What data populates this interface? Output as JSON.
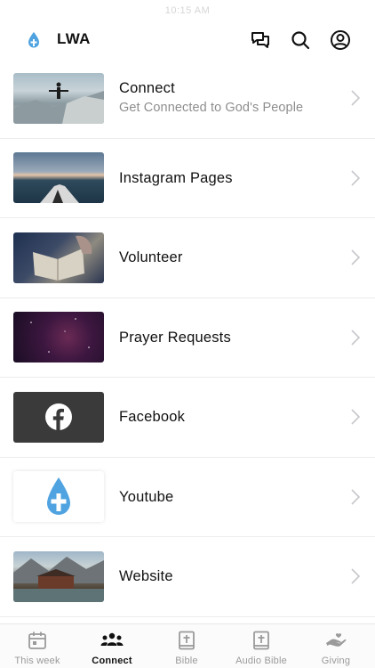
{
  "status_bar": {
    "time": "10:15 AM"
  },
  "header": {
    "title": "LWA"
  },
  "items": [
    {
      "title": "Connect",
      "subtitle": "Get Connected to God's People"
    },
    {
      "title": "Instagram Pages",
      "subtitle": ""
    },
    {
      "title": "Volunteer",
      "subtitle": ""
    },
    {
      "title": "Prayer Requests",
      "subtitle": ""
    },
    {
      "title": "Facebook",
      "subtitle": ""
    },
    {
      "title": "Youtube",
      "subtitle": ""
    },
    {
      "title": "Website",
      "subtitle": ""
    }
  ],
  "tabs": [
    {
      "label": "This week",
      "icon": "calendar-icon",
      "active": false
    },
    {
      "label": "Connect",
      "icon": "people-icon",
      "active": true
    },
    {
      "label": "Bible",
      "icon": "bible-icon",
      "active": false
    },
    {
      "label": "Audio Bible",
      "icon": "audio-bible-icon",
      "active": false
    },
    {
      "label": "Giving",
      "icon": "giving-hand-icon",
      "active": false
    }
  ],
  "colors": {
    "brand_drop": "#4fa3e0",
    "facebook_tile": "#3a3a3a",
    "active_tab": "#111111",
    "inactive_tab": "#9a9a9a"
  }
}
